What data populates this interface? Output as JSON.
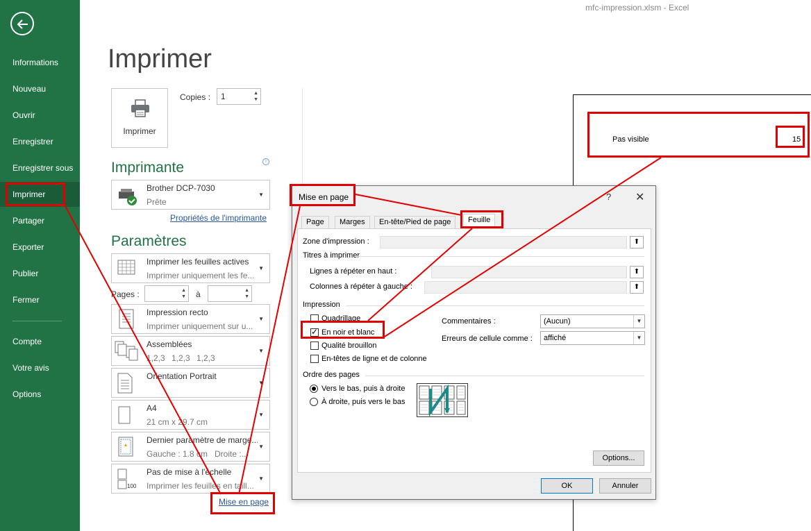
{
  "window": {
    "title": "mfc-impression.xlsm  -  Excel"
  },
  "sidebar": {
    "items": [
      {
        "label": "Informations"
      },
      {
        "label": "Nouveau"
      },
      {
        "label": "Ouvrir"
      },
      {
        "label": "Enregistrer"
      },
      {
        "label": "Enregistrer sous"
      },
      {
        "label": "Imprimer"
      },
      {
        "label": "Partager"
      },
      {
        "label": "Exporter"
      },
      {
        "label": "Publier"
      },
      {
        "label": "Fermer"
      },
      {
        "label": "Compte"
      },
      {
        "label": "Votre avis"
      },
      {
        "label": "Options"
      }
    ]
  },
  "print": {
    "title": "Imprimer",
    "button_label": "Imprimer",
    "copies_label": "Copies :",
    "copies_value": "1"
  },
  "printer": {
    "section_title": "Imprimante",
    "name": "Brother DCP-7030",
    "status": "Prête",
    "properties_link": "Propriétés de l'imprimante"
  },
  "settings": {
    "section_title": "Paramètres",
    "what": {
      "main": "Imprimer les feuilles actives",
      "sub": "Imprimer uniquement les fe..."
    },
    "pages_label": "Pages :",
    "pages_to": "à",
    "sides": {
      "main": "Impression recto",
      "sub": "Imprimer uniquement sur u..."
    },
    "collate": {
      "main": "Assemblées",
      "sub1": "1,2,3",
      "sub2": "1,2,3",
      "sub3": "1,2,3"
    },
    "orientation": {
      "main": "Orientation Portrait"
    },
    "paper": {
      "main": "A4",
      "sub": "21 cm x 29.7 cm"
    },
    "margins": {
      "main": "Dernier paramètre de marge...",
      "sub_left": "Gauche : 1.8 cm",
      "sub_right": "Droite :..."
    },
    "scaling": {
      "main": "Pas de mise à l'échelle",
      "sub": "Imprimer les feuilles en taill..."
    },
    "page_setup_link": "Mise en page"
  },
  "preview": {
    "text": "Pas visible",
    "number": "15"
  },
  "dialog": {
    "title": "Mise en page",
    "help": "?",
    "close": "✕",
    "tabs": [
      "Page",
      "Marges",
      "En-tête/Pied de page",
      "Feuille"
    ],
    "print_area_label": "Zone d'impression :",
    "print_titles_label": "Titres à imprimer",
    "rows_repeat_label": "Lignes à répéter en haut :",
    "cols_repeat_label": "Colonnes à répéter à gauche :",
    "print_group_label": "Impression",
    "gridlines_label": "Quadrillage",
    "bw_label": "En noir et blanc",
    "draft_label": "Qualité brouillon",
    "headings_label": "En-têtes de ligne et de colonne",
    "comments_label": "Commentaires :",
    "comments_value": "(Aucun)",
    "errors_label": "Erreurs de cellule comme :",
    "errors_value": "affiché",
    "order_label": "Ordre des pages",
    "order_down": "Vers le bas, puis à droite",
    "order_over": "À droite, puis vers le bas",
    "options_button": "Options...",
    "ok_button": "OK",
    "cancel_button": "Annuler",
    "checked": {
      "gridlines": false,
      "bw": true,
      "draft": false,
      "headings": false
    },
    "order_selected": "down"
  },
  "colors": {
    "accent": "#217346",
    "highlight": "#e00000"
  }
}
